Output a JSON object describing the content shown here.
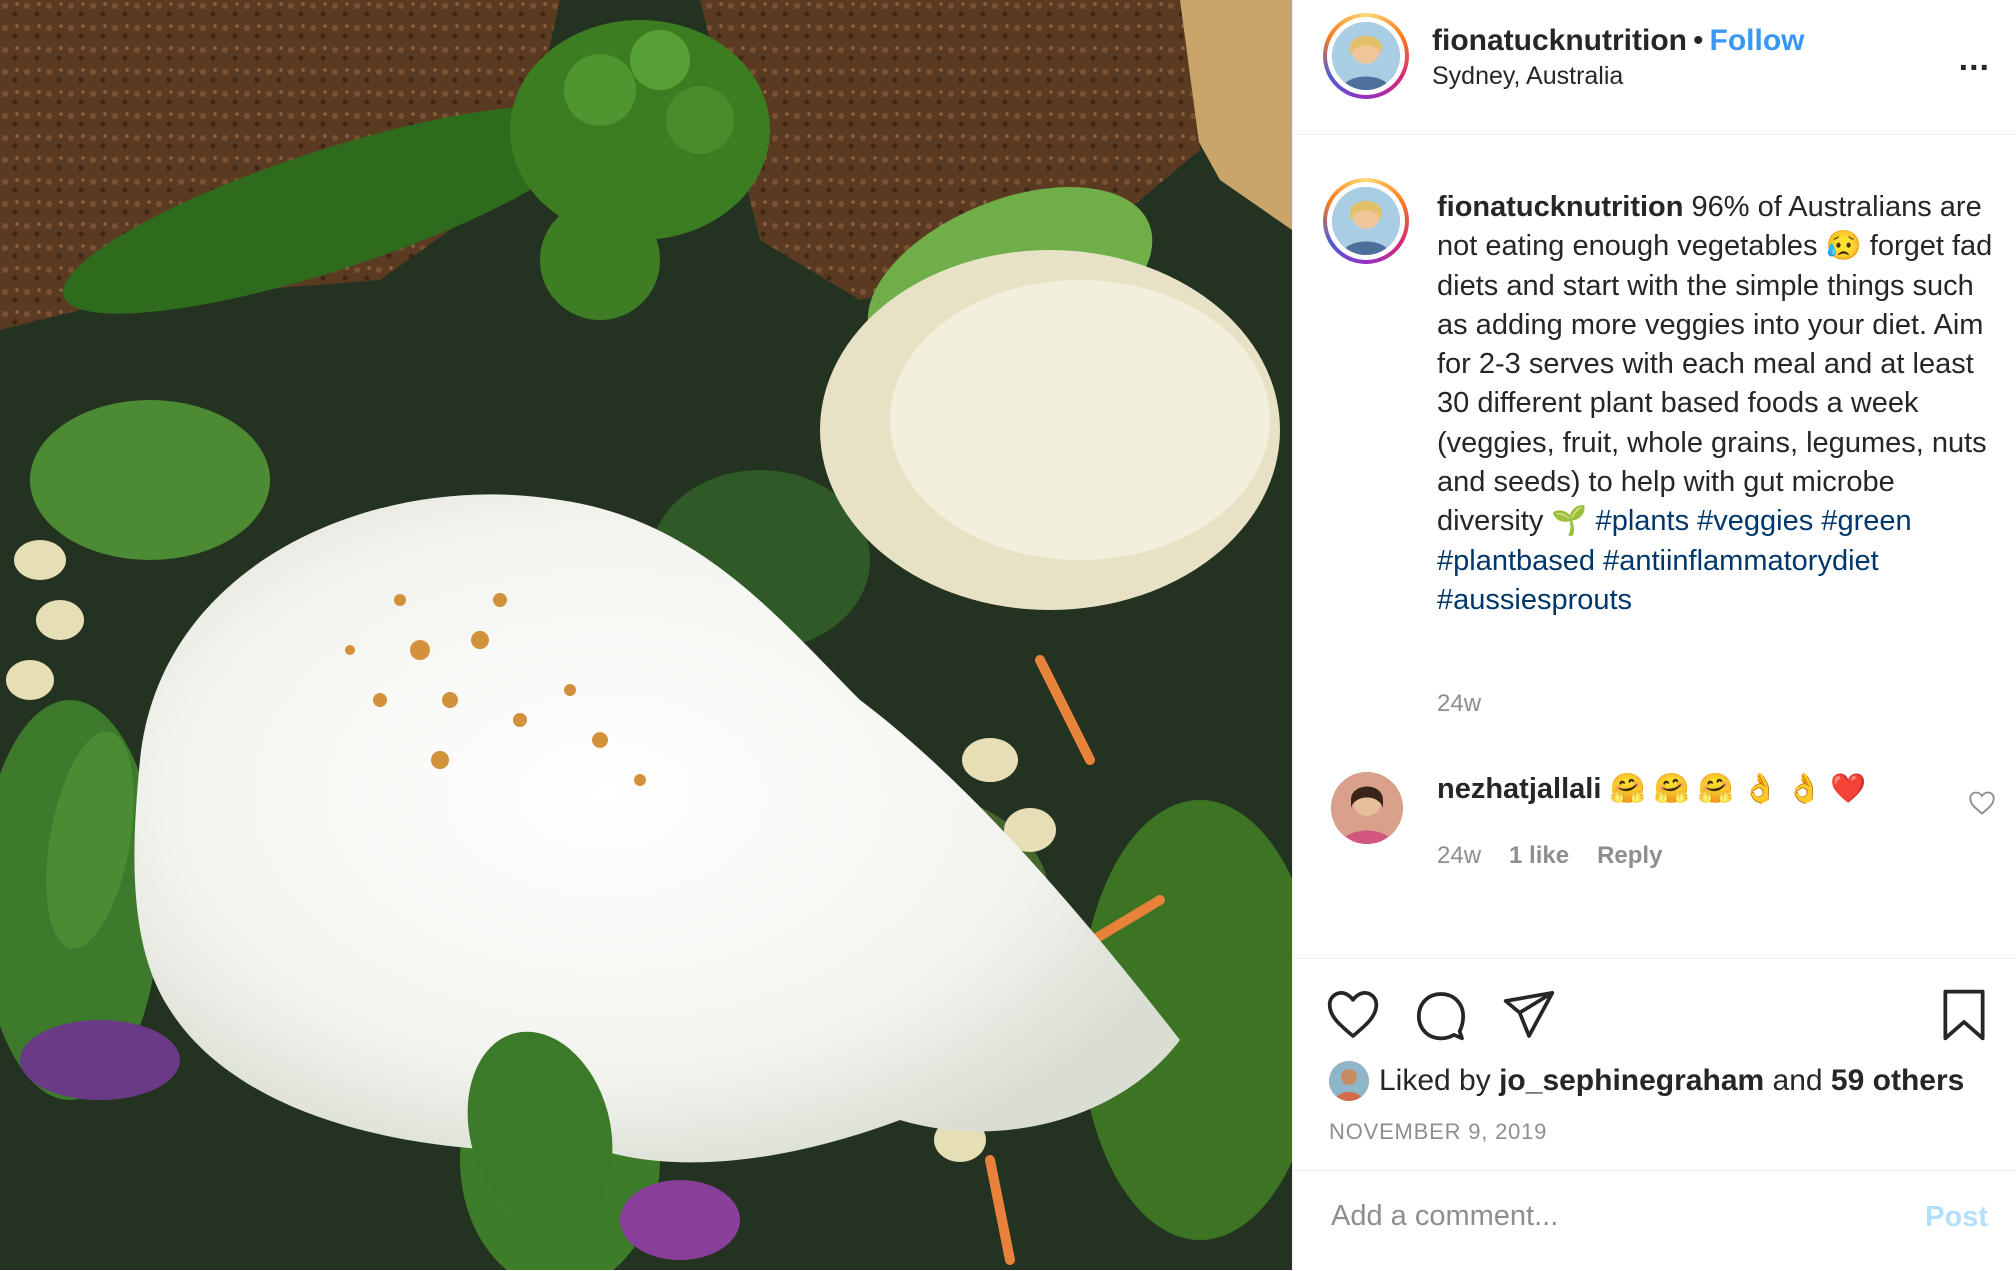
{
  "header": {
    "username": "fionatucknutrition",
    "separator": "•",
    "follow_label": "Follow",
    "location": "Sydney, Australia",
    "more_label": "..."
  },
  "photo": {
    "icon": "poached-egg-salad-photo"
  },
  "caption": {
    "username": "fionatucknutrition",
    "text_before": " 96% of Australians are not eating enough vegetables 😥 forget fad diets and start with the simple things such as adding more veggies into your diet. Aim for 2-3 serves with each meal and at least 30 different plant based foods a week (veggies, fruit, whole grains, legumes, nuts and seeds) to help with gut microbe diversity 🌱 ",
    "hashtags": [
      "#plants",
      "#veggies",
      "#green",
      "#plantbased",
      "#antiinflammatorydiet",
      "#aussiesprouts"
    ],
    "time": "24w"
  },
  "comment": {
    "username": "nezhatjallali",
    "text": " 🤗 🤗 🤗 👌 👌 ❤️",
    "time": "24w",
    "likes": "1 like",
    "reply_label": "Reply"
  },
  "actions": {
    "liked_prefix": "Liked by ",
    "liked_user": "jo_sephinegraham",
    "liked_mid": " and ",
    "liked_others": "59 others",
    "date": "NOVEMBER 9, 2019"
  },
  "comment_box": {
    "placeholder": "Add a comment...",
    "post_label": "Post"
  },
  "colors": {
    "link_blue": "#3897f0",
    "hashtag": "#00376b",
    "muted": "#8e8e8e",
    "post_disabled": "#b2dffc"
  }
}
